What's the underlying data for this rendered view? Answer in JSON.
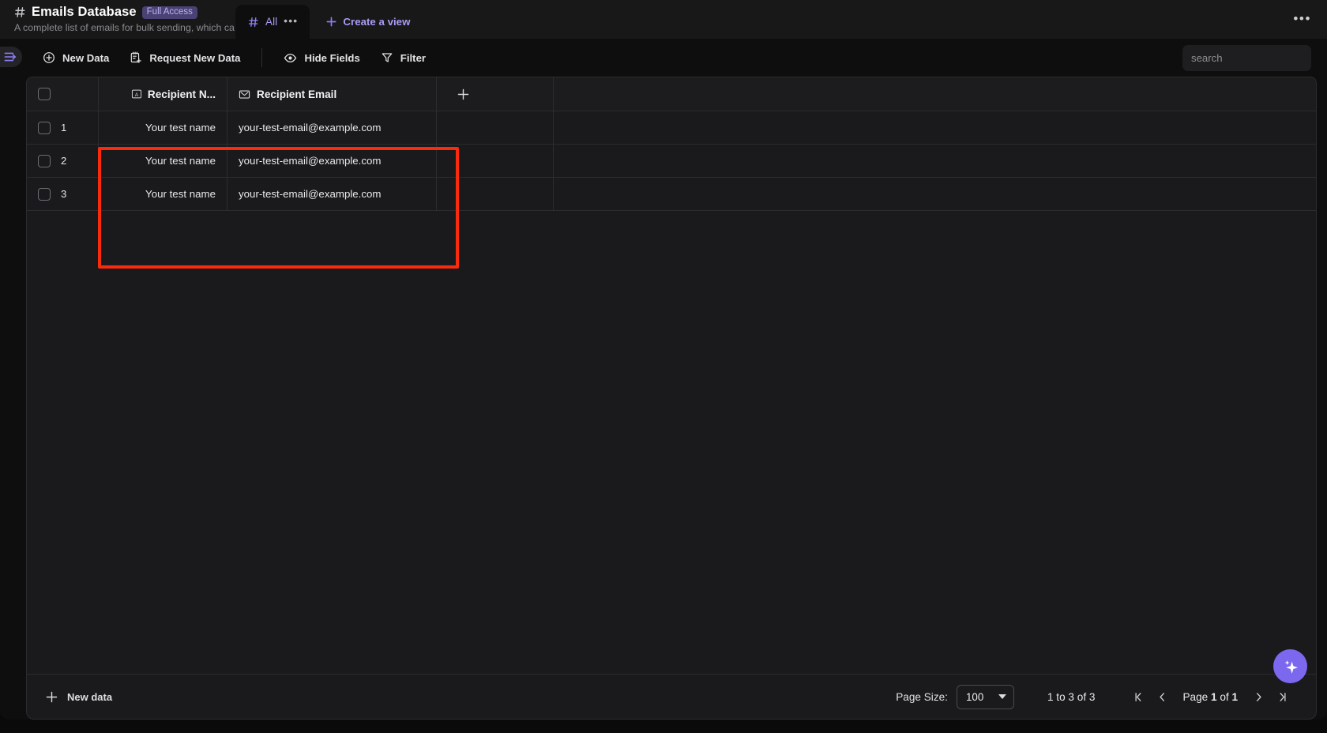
{
  "header": {
    "hash_icon": "hash-icon",
    "title": "Emails Database",
    "access_badge": "Full Access",
    "subtitle": "A complete list of emails for bulk sending, which ca...",
    "overflow_menu": "•••"
  },
  "tabs": {
    "items": [
      {
        "label": "All",
        "icon": "hash-icon",
        "active": true,
        "menu": "•••"
      }
    ],
    "create_view_label": "Create a view",
    "create_view_icon": "plus-icon"
  },
  "toolbar": {
    "buttons": [
      {
        "label": "New Data",
        "icon": "plus-circle-icon"
      },
      {
        "label": "Request New Data",
        "icon": "clipboard-plus-icon"
      },
      {
        "label": "Hide Fields",
        "icon": "eye-icon"
      },
      {
        "label": "Filter",
        "icon": "funnel-icon"
      }
    ],
    "sidebar_toggle_icon": "expand-sidebar-icon"
  },
  "search": {
    "placeholder": "search",
    "value": ""
  },
  "table": {
    "columns": [
      {
        "label": "Recipient N...",
        "icon": "text-field-icon"
      },
      {
        "label": "Recipient Email",
        "icon": "email-field-icon"
      }
    ],
    "add_column_icon": "plus-icon",
    "select_all_checkbox": false,
    "rows": [
      {
        "index": "1",
        "name": "Your test name",
        "email": "your-test-email@example.com"
      },
      {
        "index": "2",
        "name": "Your test name",
        "email": "your-test-email@example.com"
      },
      {
        "index": "3",
        "name": "Your test name",
        "email": "your-test-email@example.com"
      }
    ]
  },
  "annotation": {
    "color": "#fa2a0c",
    "shape": "rectangle"
  },
  "footer": {
    "new_data_label": "New data",
    "new_data_icon": "plus-icon",
    "page_size_label": "Page Size:",
    "page_size_value": "100",
    "range_text": "1 to 3 of 3",
    "first_page_icon": "first-page-icon",
    "prev_page_icon": "chevron-left-icon",
    "page_text_prefix": "Page",
    "page_current": "1",
    "page_text_mid": "of",
    "page_total": "1",
    "next_page_icon": "chevron-right-icon",
    "last_page_icon": "last-page-icon"
  },
  "ai_button": {
    "icon": "sparkle-icon",
    "color": "#7b68ee"
  }
}
